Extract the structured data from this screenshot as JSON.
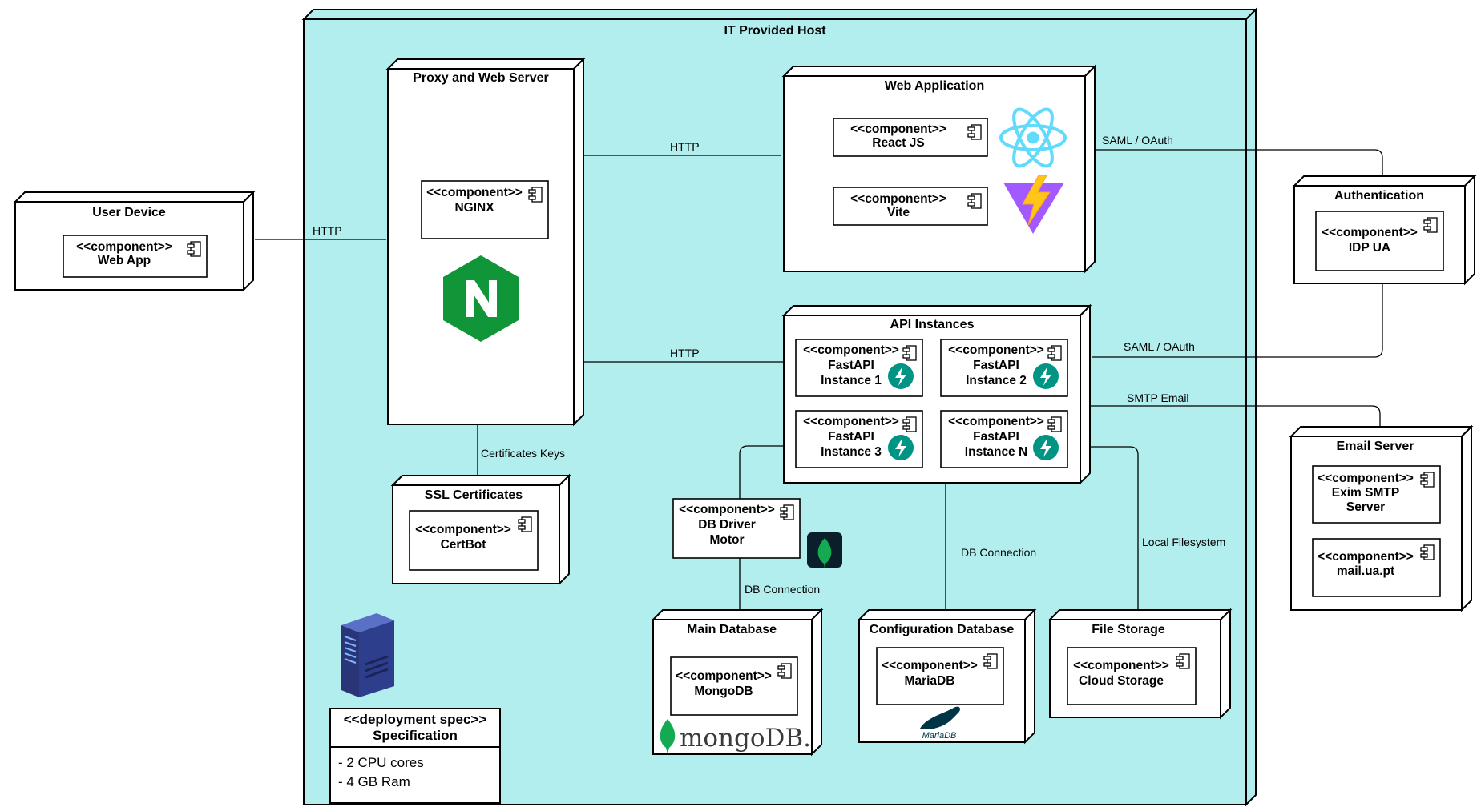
{
  "host": {
    "title": "IT Provided Host",
    "color": "#b2eeee"
  },
  "nodes": {
    "user_device": {
      "title": "User Device",
      "component": [
        "<<component>>",
        "Web App"
      ]
    },
    "proxy": {
      "title": "Proxy and Web Server",
      "component": [
        "<<component>>",
        "NGINX"
      ]
    },
    "web_app": {
      "title": "Web Application",
      "components": [
        [
          "<<component>>",
          "React JS"
        ],
        [
          "<<component>>",
          "Vite"
        ]
      ]
    },
    "auth": {
      "title": "Authentication",
      "component": [
        "<<component>>",
        "IDP UA"
      ]
    },
    "api": {
      "title": "API Instances",
      "instances": [
        [
          "<<component>>",
          "FastAPI",
          "Instance 1"
        ],
        [
          "<<component>>",
          "FastAPI",
          "Instance 2"
        ],
        [
          "<<component>>",
          "FastAPI",
          "Instance 3"
        ],
        [
          "<<component>>",
          "FastAPI",
          "Instance N"
        ]
      ]
    },
    "email": {
      "title": "Email Server",
      "components": [
        [
          "<<component>>",
          "Exim SMTP",
          "Server"
        ],
        [
          "<<component>>",
          "mail.ua.pt"
        ]
      ]
    },
    "ssl": {
      "title": "SSL Certificates",
      "component": [
        "<<component>>",
        "CertBot"
      ]
    },
    "db_driver": {
      "component": [
        "<<component>>",
        "DB Driver",
        "Motor"
      ]
    },
    "main_db": {
      "title": "Main Database",
      "component": [
        "<<component>>",
        "MongoDB"
      ],
      "logo_text": "mongoDB."
    },
    "config_db": {
      "title": "Configuration Database",
      "component": [
        "<<component>>",
        "MariaDB"
      ],
      "logo_text": "MariaDB"
    },
    "file_storage": {
      "title": "File Storage",
      "component": [
        "<<component>>",
        "Cloud Storage"
      ]
    }
  },
  "spec": {
    "header": [
      "<<deployment spec>>",
      "Specification"
    ],
    "items": [
      "- 2 CPU cores",
      "- 4 GB Ram"
    ]
  },
  "edges": {
    "user_proxy": "HTTP",
    "proxy_web": "HTTP",
    "proxy_api": "HTTP",
    "web_auth": "SAML / OAuth",
    "api_auth": "SAML / OAuth",
    "api_email": "SMTP Email",
    "proxy_ssl": "Certificates Keys",
    "driver_maindb": "DB Connection",
    "api_configdb": "DB Connection",
    "api_files": "Local Filesystem"
  },
  "colors": {
    "nginx": "#109639",
    "react": "#61dafb",
    "fastapi": "#009485",
    "mongo_leaf": "#13aa52",
    "mongo_badge": "#0b1f2a",
    "vite_purple": "#a259ff",
    "vite_yellow": "#ffc517",
    "server_blue": "#2c3e8c"
  },
  "icons": [
    "component-icon",
    "react-logo",
    "vite-logo",
    "nginx-logo",
    "fastapi-icon",
    "mongodb-leaf-icon",
    "mongodb-logo",
    "mariadb-seal-logo",
    "server-rack-icon"
  ]
}
